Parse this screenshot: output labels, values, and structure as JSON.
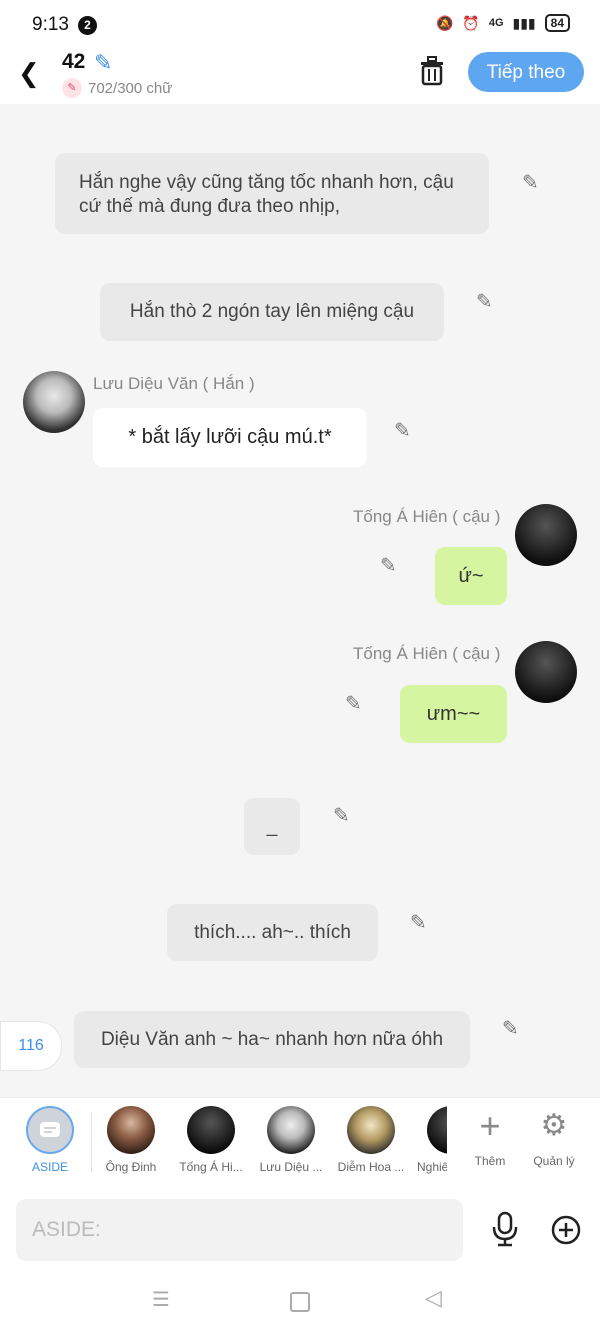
{
  "status": {
    "time": "9:13",
    "notif_count": "2",
    "network": "4G",
    "battery": "84"
  },
  "header": {
    "chapter": "42",
    "word_count": "702/300 chữ",
    "next_label": "Tiếp theo"
  },
  "messages": [
    {
      "kind": "narration",
      "text": "Hắn nghe vậy cũng tăng tốc nhanh hơn, cậu cứ thế mà đung đưa theo nhịp,"
    },
    {
      "kind": "narration",
      "text": "Hắn thò 2 ngón tay lên miệng cậu"
    },
    {
      "kind": "left",
      "name": "Lưu Diệu Văn ( Hắn )",
      "text": "* bắt lấy lưỡi cậu mú.t*"
    },
    {
      "kind": "right",
      "name": "Tống Á Hiên ( cậu )",
      "text": "ứ~"
    },
    {
      "kind": "right",
      "name": "Tống Á Hiên ( cậu )",
      "text": "ưm~~"
    },
    {
      "kind": "narration",
      "text": "_"
    },
    {
      "kind": "narration",
      "text": "thích.... ah~.. thích"
    },
    {
      "kind": "narration",
      "text": "Diệu Văn anh ~ ha~ nhanh hơn nữa óhh"
    }
  ],
  "side_count": "116",
  "characters": [
    {
      "label": "ASIDE"
    },
    {
      "label": "Ông Đinh"
    },
    {
      "label": "Tống Á Hi..."
    },
    {
      "label": "Lưu Diệu ..."
    },
    {
      "label": "Diễm Hoa ..."
    },
    {
      "label": "Nghiê"
    }
  ],
  "char_actions": {
    "add": "Thêm",
    "manage": "Quản lý"
  },
  "input": {
    "placeholder": "ASIDE:"
  },
  "colors": {
    "accent": "#5ea6ef",
    "green_bubble": "#d6f5a1",
    "narration_bubble": "#e9e9e9"
  }
}
